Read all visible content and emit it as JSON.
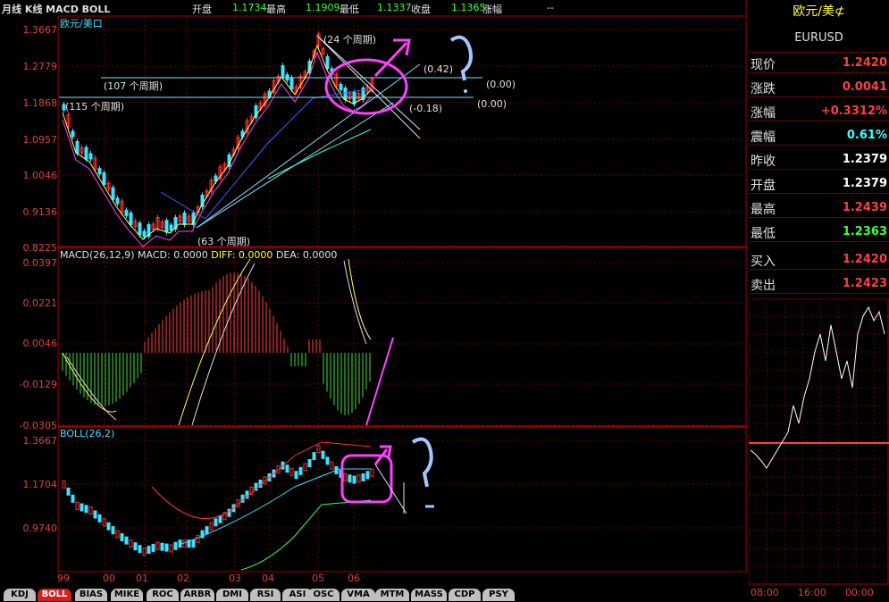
{
  "header": {
    "title": "月线 K线 MACD BOLL",
    "open_label": "开盘",
    "open_value": "1.1734",
    "high_label": "最高",
    "high_value": "1.1909",
    "low_label": "最低",
    "low_value": "1.1337",
    "close_label": "收盘",
    "close_value": "1.1365",
    "change_label": "涨幅",
    "change_value": "--"
  },
  "main_chart": {
    "symbol_label": "欧元/美口",
    "y_ticks": [
      "1.3667",
      "1.2779",
      "1.1868",
      "1.0957",
      "1.0046",
      "0.9136",
      "0.8225"
    ],
    "annotations": {
      "p24": "(24 个周期)",
      "p107": "(107 个周期)",
      "p115": "(115 个周期)",
      "p63": "(63 个周期)",
      "f042": "(0.42)",
      "f000a": "(0.00)",
      "f000b": "(0.00)",
      "f018": "(-0.18)"
    }
  },
  "macd_panel": {
    "label_name": "MACD(26,12,9)",
    "label_macd": "MACD: 0.0000",
    "label_diff": "DIFF: 0.0000",
    "label_dea": "DEA: 0.0000",
    "y_ticks": [
      "0.0397",
      "0.0221",
      "0.0046",
      "-0.0129",
      "-0.0305"
    ]
  },
  "boll_panel": {
    "label": "BOLL(26,2)",
    "y_ticks": [
      "1.3667",
      "1.1704",
      "0.9740"
    ]
  },
  "x_axis": [
    "99",
    "00",
    "01",
    "02",
    "03",
    "04",
    "05",
    "06"
  ],
  "tabs": [
    "KDJ",
    "BOLL",
    "BIAS",
    "MIKE",
    "ROC",
    "ARBR",
    "DMI",
    "RSI",
    "ASI",
    "OSC",
    "VMA",
    "MTM",
    "MASS",
    "CDP",
    "PSY"
  ],
  "active_tab": "BOLL",
  "quote_panel": {
    "name": "欧元/美⊄",
    "code": "EURUSD",
    "rows": [
      {
        "label": "现价",
        "value": "1.2420",
        "color": "#ff4040"
      },
      {
        "label": "涨跌",
        "value": "0.0041",
        "color": "#ff4040"
      },
      {
        "label": "涨幅",
        "value": "+0.3312%",
        "color": "#ff4040"
      },
      {
        "label": "震幅",
        "value": "0.61%",
        "color": "#40ffff"
      },
      {
        "label": "昨收",
        "value": "1.2379",
        "color": "#ffffff"
      },
      {
        "label": "开盘",
        "value": "1.2379",
        "color": "#ffffff"
      },
      {
        "label": "最高",
        "value": "1.2439",
        "color": "#ff4040"
      },
      {
        "label": "最低",
        "value": "1.2363",
        "color": "#3cff3c"
      },
      {
        "label": "买入",
        "value": "1.2420",
        "color": "#ff4040"
      },
      {
        "label": "卖出",
        "value": "1.2423",
        "color": "#ff4040"
      }
    ],
    "time_axis": [
      "08:00",
      "16:00",
      "00:00"
    ]
  },
  "colors": {
    "grid": "#700000",
    "up": "#ff3030",
    "down": "#40e0ff",
    "accent": "#ff40ff"
  }
}
